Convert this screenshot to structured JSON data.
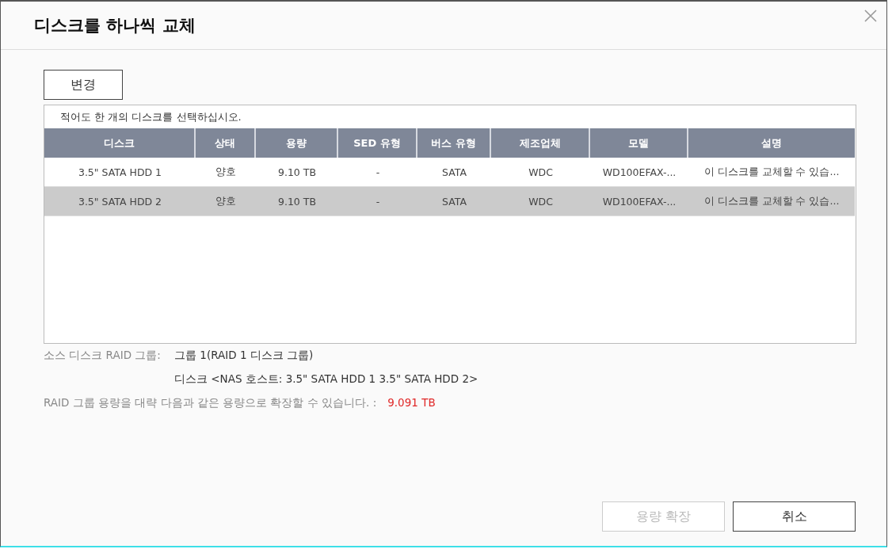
{
  "window": {
    "title": "디스크를 하나씩 교체"
  },
  "change_button": "변경",
  "table": {
    "hint": "적어도 한 개의 디스크를 선택하십시오.",
    "columns": [
      "디스크",
      "상태",
      "용량",
      "SED 유형",
      "버스 유형",
      "제조업체",
      "모델",
      "설명"
    ],
    "rows": [
      {
        "selected": false,
        "cells": [
          "3.5\" SATA HDD 1",
          "양호",
          "9.10 TB",
          "-",
          "SATA",
          "WDC",
          "WD100EFAX-...",
          "이 디스크를 교체할 수 있습..."
        ]
      },
      {
        "selected": true,
        "cells": [
          "3.5\" SATA HDD 2",
          "양호",
          "9.10 TB",
          "-",
          "SATA",
          "WDC",
          "WD100EFAX-...",
          "이 디스크를 교체할 수 있습..."
        ]
      }
    ]
  },
  "info": {
    "source_label": "소스 디스크 RAID 그룹:",
    "source_value": "그룹 1(RAID 1 디스크 그룹)",
    "disks_value": "디스크 <NAS 호스트: 3.5\" SATA HDD 1 3.5\" SATA HDD 2>",
    "capacity_label": "RAID 그룹 용량을 대략 다음과 같은 용량으로 확장할 수 있습니다. :",
    "capacity_value": "9.091 TB"
  },
  "buttons": [
    {
      "label": "용량 확장",
      "disabled": true
    },
    {
      "label": "취소",
      "disabled": false
    }
  ]
}
